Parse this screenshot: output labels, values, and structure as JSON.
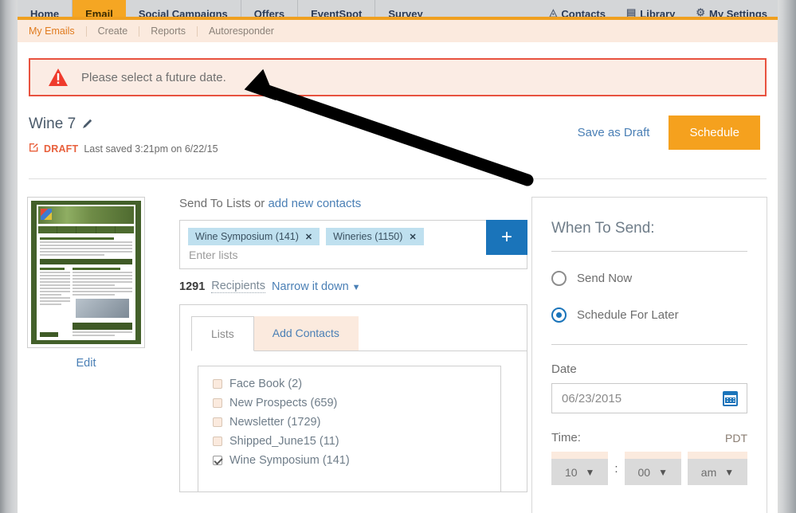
{
  "topnav": {
    "items": [
      {
        "label": "Home",
        "active": false
      },
      {
        "label": "Email",
        "active": true
      },
      {
        "label": "Social Campaigns",
        "active": false
      },
      {
        "label": "Offers",
        "active": false
      },
      {
        "label": "EventSpot",
        "active": false
      },
      {
        "label": "Survey",
        "active": false
      }
    ],
    "right_items": [
      {
        "label": "Contacts",
        "icon": "contacts-icon",
        "glyph": "◬"
      },
      {
        "label": "Library",
        "icon": "library-icon",
        "glyph": "▤"
      },
      {
        "label": "My Settings",
        "icon": "gear-icon",
        "glyph": "⚙"
      }
    ]
  },
  "subnav": {
    "items": [
      {
        "label": "My Emails",
        "active": true
      },
      {
        "label": "Create",
        "active": false
      },
      {
        "label": "Reports",
        "active": false
      },
      {
        "label": "Autoresponder",
        "active": false
      }
    ]
  },
  "alert": {
    "icon": "warning-triangle-icon",
    "message": "Please select a future date."
  },
  "campaign": {
    "name": "Wine 7",
    "edit_icon": "pencil-icon",
    "status_icon": "draft-edit-icon",
    "status": "DRAFT",
    "last_saved": "Last saved 3:21pm on 6/22/15"
  },
  "actions": {
    "save_draft_label": "Save as Draft",
    "schedule_label": "Schedule"
  },
  "preview": {
    "edit_label": "Edit"
  },
  "send_to": {
    "label_prefix": "Send To Lists or ",
    "add_contacts_link": "add new contacts",
    "chips": [
      {
        "label": "Wine Symposium (141)"
      },
      {
        "label": "Wineries (1150)"
      }
    ],
    "input_placeholder": "Enter lists",
    "add_button_icon": "plus-icon",
    "recipients_count": "1291",
    "recipients_word": "Recipients",
    "narrow_label": "Narrow it down",
    "narrow_caret": "⌄"
  },
  "lists_panel": {
    "tabs": [
      {
        "label": "Lists",
        "active": true
      },
      {
        "label": "Add Contacts",
        "active": false
      }
    ],
    "items": [
      {
        "label": "Face Book (2)",
        "checked": false
      },
      {
        "label": "New Prospects (659)",
        "checked": false
      },
      {
        "label": "Newsletter (1729)",
        "checked": false
      },
      {
        "label": "Shipped_June15 (11)",
        "checked": false
      },
      {
        "label": "Wine Symposium (141)",
        "checked": true
      }
    ]
  },
  "when_to_send": {
    "title": "When To Send:",
    "options": [
      {
        "label": "Send Now",
        "selected": false
      },
      {
        "label": "Schedule For Later",
        "selected": true
      }
    ],
    "date_label": "Date",
    "date_value": "06/23/2015",
    "calendar_icon": "calendar-icon",
    "time_label": "Time:",
    "timezone": "PDT",
    "hour_value": "10",
    "minute_value": "00",
    "meridiem_value": "am",
    "colon": ":",
    "caret_glyph": "⌄"
  },
  "colors": {
    "accent_orange": "#f5a11e",
    "nav_active": "#f5a623",
    "link_blue": "#4a7fb5",
    "alert_border": "#e8523f",
    "alert_bg": "#fbece4",
    "chip_bg": "#bfe0ef",
    "plus_blue": "#1a74ba",
    "subnav_bg": "#fbeade"
  },
  "annotation": {
    "arrow": "black-arrow-annotation"
  }
}
